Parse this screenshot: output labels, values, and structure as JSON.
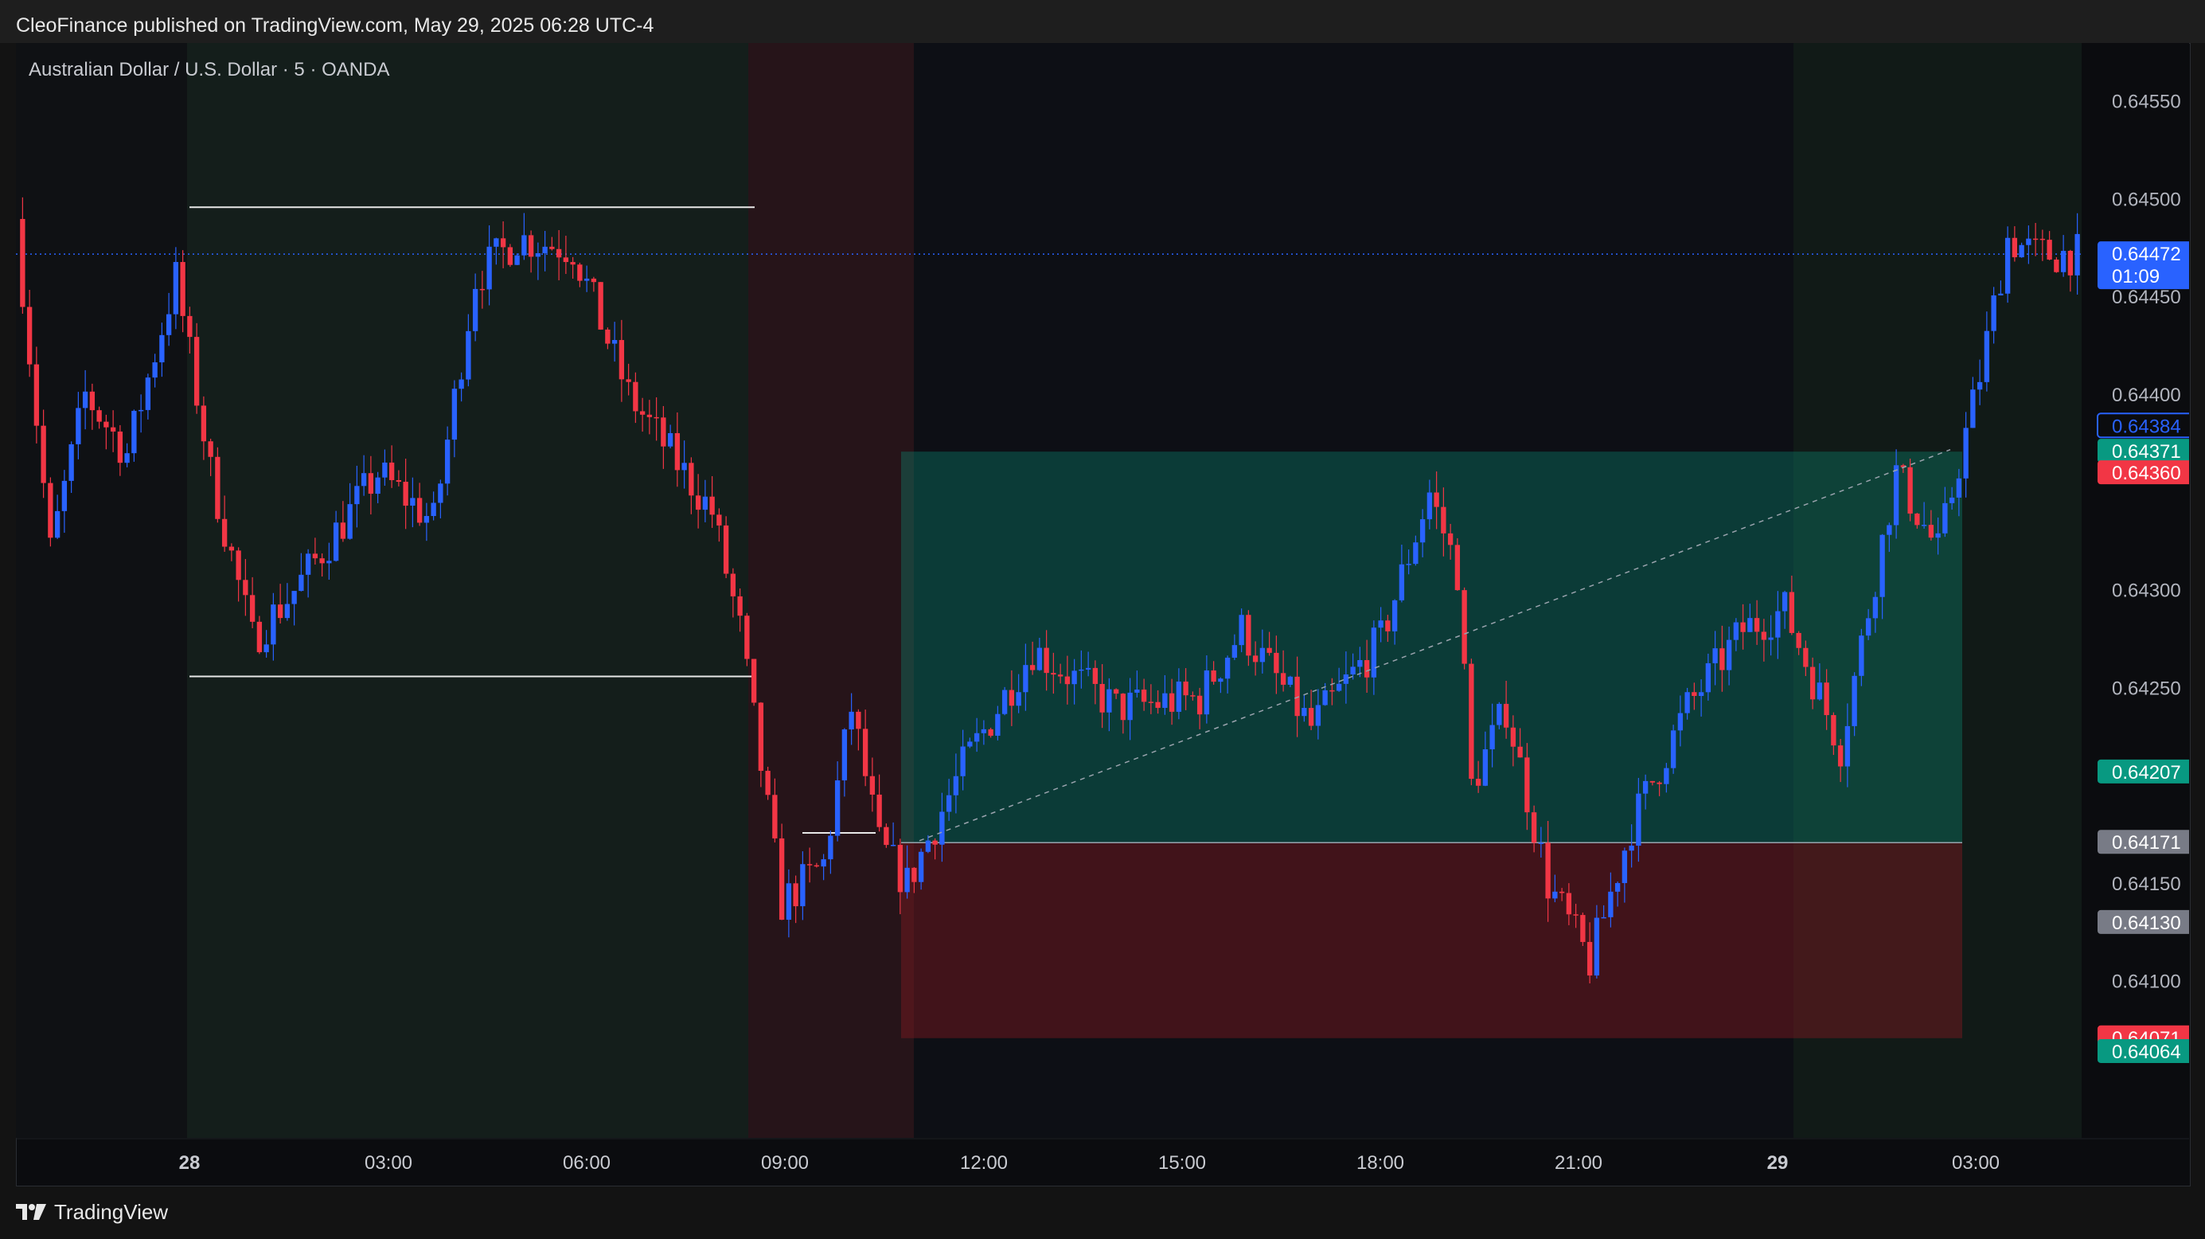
{
  "header": {
    "published_by": "CleoFinance published on TradingView.com, May 29, 2025 06:28 UTC-4",
    "symbol": "Australian Dollar / U.S. Dollar · 5 · OANDA",
    "brand": "TradingView"
  },
  "colors": {
    "up": "#2962ff",
    "down": "#f23645",
    "profit_zone": "#089981",
    "loss_zone": "#801922",
    "badge_blue": "#2962ff",
    "badge_green": "#089981",
    "badge_red": "#f23645",
    "badge_grey": "#787b86"
  },
  "chart_data": {
    "type": "candlestick",
    "x_ticks": [
      "28",
      "03:00",
      "06:00",
      "09:00",
      "12:00",
      "15:00",
      "18:00",
      "21:00",
      "29",
      "03:00"
    ],
    "x_tick_bold": [
      true,
      false,
      false,
      false,
      false,
      false,
      false,
      false,
      true,
      false
    ],
    "y_ticks": [
      "0.64550",
      "0.64500",
      "0.64450",
      "0.64400",
      "0.64300",
      "0.64250",
      "0.64150",
      "0.64100"
    ],
    "ylim": [
      0.6402,
      0.6458
    ],
    "price_labels": [
      {
        "line1": "0.64472",
        "line2": "01:09",
        "style": "blue"
      },
      {
        "line1": "0.64384",
        "style": "outline"
      },
      {
        "line1": "0.64371",
        "style": "green"
      },
      {
        "line1": "0.64360",
        "style": "red"
      },
      {
        "line1": "0.64207",
        "style": "green"
      },
      {
        "line1": "0.64171",
        "style": "grey"
      },
      {
        "line1": "0.64130",
        "style": "grey"
      },
      {
        "line1": "0.64071",
        "style": "red"
      },
      {
        "line1": "0.64064",
        "style": "green"
      }
    ],
    "levels": {
      "current_price": 0.64472,
      "range_high": 0.64496,
      "range_low": 0.64256,
      "entry": 0.64171,
      "take_profit": 0.64371,
      "stop_loss": 0.64071
    },
    "ohlc_anchors": [
      {
        "t": 0,
        "p": 0.6449
      },
      {
        "t": 5,
        "p": 0.6432
      },
      {
        "t": 10,
        "p": 0.644
      },
      {
        "t": 16,
        "p": 0.6437
      },
      {
        "t": 23,
        "p": 0.6446
      },
      {
        "t": 28,
        "p": 0.6436
      },
      {
        "t": 34,
        "p": 0.64275
      },
      {
        "t": 40,
        "p": 0.643
      },
      {
        "t": 52,
        "p": 0.6436
      },
      {
        "t": 60,
        "p": 0.64335
      },
      {
        "t": 66,
        "p": 0.6446
      },
      {
        "t": 72,
        "p": 0.6448
      },
      {
        "t": 80,
        "p": 0.64475
      },
      {
        "t": 88,
        "p": 0.644
      },
      {
        "t": 95,
        "p": 0.64365
      },
      {
        "t": 100,
        "p": 0.6434
      },
      {
        "t": 104,
        "p": 0.6428
      },
      {
        "t": 110,
        "p": 0.6414
      },
      {
        "t": 116,
        "p": 0.6416
      },
      {
        "t": 120,
        "p": 0.6424
      },
      {
        "t": 124,
        "p": 0.6417
      },
      {
        "t": 128,
        "p": 0.6415
      },
      {
        "t": 136,
        "p": 0.6421
      },
      {
        "t": 146,
        "p": 0.6427
      },
      {
        "t": 158,
        "p": 0.6424
      },
      {
        "t": 170,
        "p": 0.64245
      },
      {
        "t": 176,
        "p": 0.6428
      },
      {
        "t": 186,
        "p": 0.6423
      },
      {
        "t": 196,
        "p": 0.64275
      },
      {
        "t": 203,
        "p": 0.6435
      },
      {
        "t": 207,
        "p": 0.6431
      },
      {
        "t": 209,
        "p": 0.642
      },
      {
        "t": 214,
        "p": 0.6424
      },
      {
        "t": 220,
        "p": 0.6415
      },
      {
        "t": 226,
        "p": 0.6411
      },
      {
        "t": 232,
        "p": 0.6418
      },
      {
        "t": 240,
        "p": 0.6424
      },
      {
        "t": 248,
        "p": 0.6428
      },
      {
        "t": 254,
        "p": 0.6429
      },
      {
        "t": 262,
        "p": 0.6422
      },
      {
        "t": 270,
        "p": 0.6436
      },
      {
        "t": 276,
        "p": 0.6432
      },
      {
        "t": 282,
        "p": 0.6441
      },
      {
        "t": 286,
        "p": 0.6448
      },
      {
        "t": 290,
        "p": 0.64472
      }
    ]
  }
}
